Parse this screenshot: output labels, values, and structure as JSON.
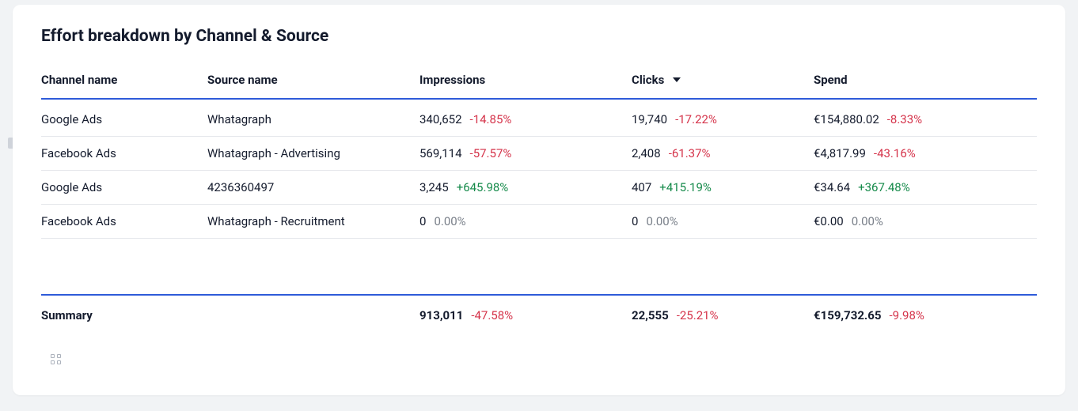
{
  "title": "Effort breakdown by Channel & Source",
  "headers": {
    "channel": "Channel name",
    "source": "Source name",
    "impressions": "Impressions",
    "clicks": "Clicks",
    "spend": "Spend"
  },
  "sort": {
    "column": "clicks",
    "dir": "desc"
  },
  "rows": [
    {
      "channel": "Google Ads",
      "source": "Whatagraph",
      "impressions": {
        "value": "340,652",
        "pct": "-14.85%",
        "cls": "neg"
      },
      "clicks": {
        "value": "19,740",
        "pct": "-17.22%",
        "cls": "neg"
      },
      "spend": {
        "value": "€154,880.02",
        "pct": "-8.33%",
        "cls": "neg"
      }
    },
    {
      "channel": "Facebook Ads",
      "source": "Whatagraph - Advertising",
      "impressions": {
        "value": "569,114",
        "pct": "-57.57%",
        "cls": "neg"
      },
      "clicks": {
        "value": "2,408",
        "pct": "-61.37%",
        "cls": "neg"
      },
      "spend": {
        "value": "€4,817.99",
        "pct": "-43.16%",
        "cls": "neg"
      }
    },
    {
      "channel": "Google Ads",
      "source": "4236360497",
      "impressions": {
        "value": "3,245",
        "pct": "+645.98%",
        "cls": "pos"
      },
      "clicks": {
        "value": "407",
        "pct": "+415.19%",
        "cls": "pos"
      },
      "spend": {
        "value": "€34.64",
        "pct": "+367.48%",
        "cls": "pos"
      }
    },
    {
      "channel": "Facebook Ads",
      "source": "Whatagraph - Recruitment",
      "impressions": {
        "value": "0",
        "pct": "0.00%",
        "cls": "zero"
      },
      "clicks": {
        "value": "0",
        "pct": "0.00%",
        "cls": "zero"
      },
      "spend": {
        "value": "€0.00",
        "pct": "0.00%",
        "cls": "zero"
      }
    }
  ],
  "summary": {
    "label": "Summary",
    "impressions": {
      "value": "913,011",
      "pct": "-47.58%",
      "cls": "neg"
    },
    "clicks": {
      "value": "22,555",
      "pct": "-25.21%",
      "cls": "neg"
    },
    "spend": {
      "value": "€159,732.65",
      "pct": "-9.98%",
      "cls": "neg"
    }
  },
  "chart_data": {
    "type": "table",
    "columns": [
      "Channel name",
      "Source name",
      "Impressions",
      "Impressions Δ%",
      "Clicks",
      "Clicks Δ%",
      "Spend (EUR)",
      "Spend Δ%"
    ],
    "rows": [
      [
        "Google Ads",
        "Whatagraph",
        340652,
        -14.85,
        19740,
        -17.22,
        154880.02,
        -8.33
      ],
      [
        "Facebook Ads",
        "Whatagraph - Advertising",
        569114,
        -57.57,
        2408,
        -61.37,
        4817.99,
        -43.16
      ],
      [
        "Google Ads",
        "4236360497",
        3245,
        645.98,
        407,
        415.19,
        34.64,
        367.48
      ],
      [
        "Facebook Ads",
        "Whatagraph - Recruitment",
        0,
        0.0,
        0,
        0.0,
        0.0,
        0.0
      ]
    ],
    "summary": [
      "Summary",
      "",
      913011,
      -47.58,
      22555,
      -25.21,
      159732.65,
      -9.98
    ]
  }
}
